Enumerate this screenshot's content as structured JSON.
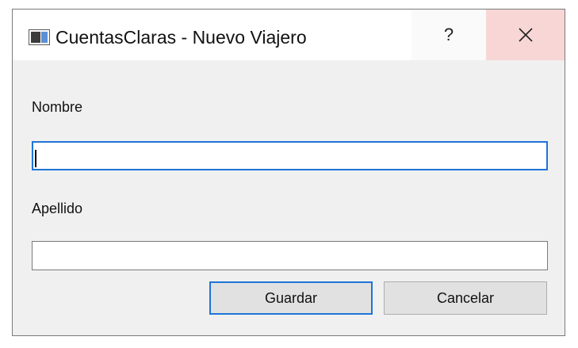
{
  "window": {
    "title": "CuentasClaras - Nuevo Viajero",
    "help_label": "?"
  },
  "form": {
    "nombre_label": "Nombre",
    "nombre_value": "",
    "apellido_label": "Apellido",
    "apellido_value": ""
  },
  "buttons": {
    "save_label": "Guardar",
    "cancel_label": "Cancelar"
  },
  "colors": {
    "accent": "#1f74d8",
    "close_hover": "#f8d6d6",
    "dialog_bg": "#f0f0f0"
  }
}
